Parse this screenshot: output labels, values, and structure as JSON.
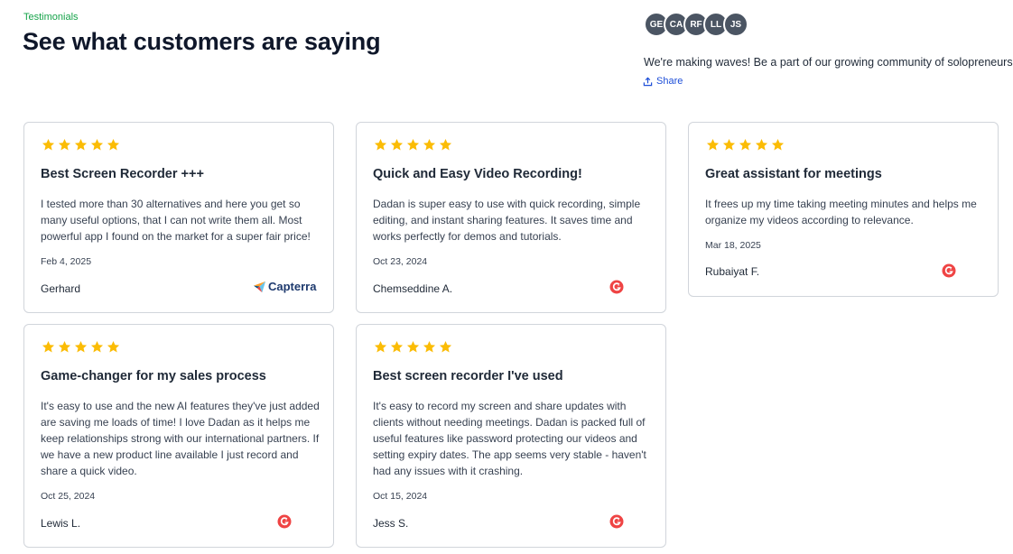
{
  "header": {
    "eyebrow": "Testimonials",
    "title": "See what customers are saying",
    "avatars": [
      "GE",
      "CA",
      "RF",
      "LL",
      "JS"
    ],
    "community_text": "We're making waves! Be a part of our growing community of solopreneurs",
    "share_label": "Share"
  },
  "colors": {
    "star": "#fbbc05",
    "g2": "#ef4444",
    "accent_green": "#16a34a",
    "link_blue": "#1d4ed8"
  },
  "testimonials": [
    {
      "title": "Best Screen Recorder +++",
      "body": "I tested more than 30 alternatives and here you get so many useful options, that I can not write them all. Most powerful app I found on the market for a super fair price!",
      "date": "Feb 4, 2025",
      "author": "Gerhard",
      "source": "Capterra",
      "rating": 5
    },
    {
      "title": "Quick and Easy Video Recording!",
      "body": "Dadan is super easy to use with quick recording, simple editing, and instant sharing features. It saves time and works perfectly for demos and tutorials.",
      "date": "Oct 23, 2024",
      "author": "Chemseddine A.",
      "source": "g2-icon",
      "rating": 5
    },
    {
      "title": "Great assistant for meetings",
      "body": "It frees up my time taking meeting minutes and helps me organize my videos according to relevance.",
      "date": "Mar 18, 2025",
      "author": "Rubaiyat F.",
      "source": "g2-icon",
      "rating": 5
    },
    {
      "title": "Game-changer for my sales process",
      "body": "It's easy to use and the new AI features they've just added are saving me loads of time! I love Dadan as it helps me keep relationships strong with our international partners. If we have a new product line available I just record and share a quick video.",
      "date": "Oct 25, 2024",
      "author": "Lewis L.",
      "source": "g2-icon",
      "rating": 5
    },
    {
      "title": "Best screen recorder I've used",
      "body": "It's easy to record my screen and share updates with clients without needing meetings. Dadan is packed full of useful features like password protecting our videos and setting expiry dates. The app seems very stable - haven't had any issues with it crashing.",
      "date": "Oct 15, 2024",
      "author": "Jess S.",
      "source": "g2-icon",
      "rating": 5
    }
  ]
}
